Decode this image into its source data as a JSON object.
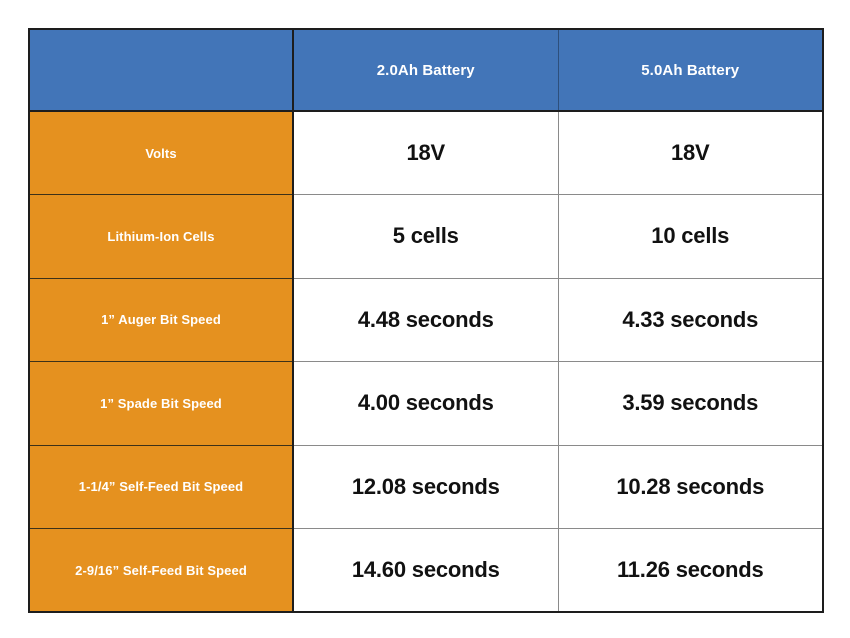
{
  "table": {
    "header": {
      "corner_label": "",
      "columns": [
        {
          "label": "2.0Ah Battery"
        },
        {
          "label": "5.0Ah Battery"
        }
      ]
    },
    "rows": [
      {
        "label": "Volts",
        "values": [
          "18V",
          "18V"
        ]
      },
      {
        "label": "Lithium-Ion Cells",
        "values": [
          "5 cells",
          "10 cells"
        ]
      },
      {
        "label": "1” Auger Bit Speed",
        "values": [
          "4.48 seconds",
          "4.33 seconds"
        ]
      },
      {
        "label": "1” Spade Bit Speed",
        "values": [
          "4.00 seconds",
          "3.59 seconds"
        ]
      },
      {
        "label": "1-1/4” Self-Feed Bit Speed",
        "values": [
          "12.08 seconds",
          "10.28 seconds"
        ]
      },
      {
        "label": "2-9/16” Self-Feed Bit Speed",
        "values": [
          "14.60 seconds",
          "11.26 seconds"
        ]
      }
    ],
    "colors": {
      "header_background": "#4275b8",
      "header_text": "#ffffff",
      "row_label_background": "#e5911f",
      "row_label_text": "#ffffff",
      "value_background": "#ffffff",
      "value_text": "#111111",
      "outer_border": "#1d1d1d",
      "inner_divider": "#8a8a8a",
      "page_background": "#ffffff"
    }
  }
}
